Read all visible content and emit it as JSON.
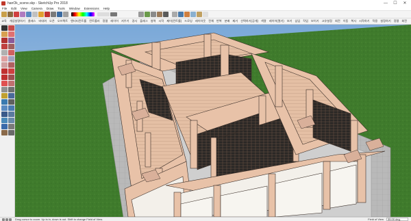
{
  "window": {
    "title": "hanOk_scene.skp - SketchUp Pro 2018",
    "minimize_glyph": "—",
    "maximize_glyph": "☐",
    "close_glyph": "✕"
  },
  "menu": [
    "File",
    "Edit",
    "View",
    "Camera",
    "Draw",
    "Tools",
    "Window",
    "Extensions",
    "Help"
  ],
  "korean_toolbar": {
    "items": [
      "교육",
      "개념설명하기",
      "클래스",
      "비대여",
      "오픈",
      "오브젝트",
      "엔티티컨트롤",
      "컨트롤러",
      "정렬",
      "레이어",
      "지우기",
      "경사",
      "플래그",
      "영역",
      "시작",
      "제어(컨트롤)",
      "드로잉",
      "레이아웃",
      "전체",
      "반복",
      "분배",
      "제거",
      "선택하기(공개)",
      "색깔",
      "레이어(열기)",
      "보기",
      "삽입",
      "작업",
      "보이기",
      "고유설정",
      "회전",
      "이동",
      "복사",
      "시작하기",
      "적용",
      "설정하기",
      "정렬",
      "회전"
    ]
  },
  "statusbar": {
    "message": "Drag cursor to zoom. Up is in, down is out. Shift to change Field of View.",
    "vcb_label": "Field of View",
    "vcb_value": "35.00 deg."
  },
  "colors": {
    "sky_top": "#6f9ed0",
    "sky_bottom": "#c9d9ea",
    "grass": "#3f7a2c",
    "grass_light": "#5a9238",
    "wood": "#e8c2a8",
    "wood_dark": "#c79a80",
    "outline": "#3a2e28",
    "plaster": "#f3f0ea",
    "paving": "#b8b8b8",
    "window_dark": "#2a2a2a"
  }
}
